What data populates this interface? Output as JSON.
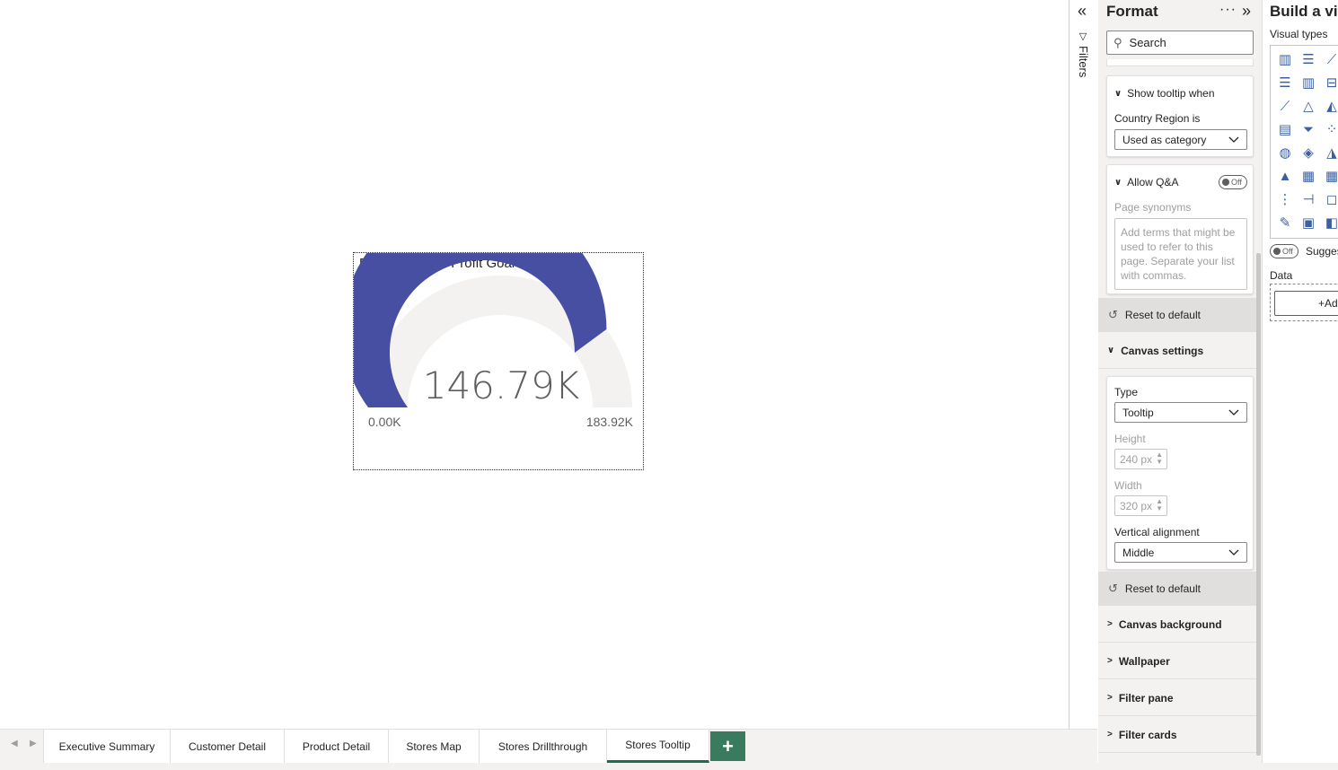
{
  "canvas": {
    "visual": {
      "title": "Profit YTD and Profit Goal",
      "gauge": {
        "value_label": "146.79K",
        "min_label": "0.00K",
        "max_label": "183.92K",
        "value": 146.79,
        "min": 0,
        "max": 183.92,
        "fill_color": "#464fa1",
        "track_color": "#f3f2f1"
      }
    }
  },
  "tabs": {
    "items": [
      {
        "label": "Executive Summary"
      },
      {
        "label": "Customer Detail"
      },
      {
        "label": "Product Detail"
      },
      {
        "label": "Stores Map"
      },
      {
        "label": "Stores Drillthrough"
      },
      {
        "label": "Stores Tooltip"
      }
    ],
    "active": "Stores Tooltip",
    "add_label": "+",
    "active_color": "#1b6f4e"
  },
  "filters": {
    "label": "Filters",
    "collapse_icon": "«"
  },
  "format": {
    "title": "Format",
    "more_icon": "···",
    "expand_icon": "»",
    "search_placeholder": "Search",
    "tooltip_section": {
      "title": "Show tooltip when",
      "field_label": "Country Region is",
      "dropdown_value": "Used as category"
    },
    "qa_section": {
      "title": "Allow Q&A",
      "toggle_label": "Off",
      "synonyms_label": "Page synonyms",
      "synonyms_placeholder": "Add terms that might be used to refer to this page. Separate your list with commas."
    },
    "reset_label": "Reset to default",
    "canvas_settings": {
      "title": "Canvas settings",
      "type_label": "Type",
      "type_value": "Tooltip",
      "height_label": "Height",
      "height_value": "240 px",
      "width_label": "Width",
      "width_value": "320 px",
      "valign_label": "Vertical alignment",
      "valign_value": "Middle"
    },
    "reset_label_2": "Reset to default",
    "sections": [
      {
        "title": "Canvas background"
      },
      {
        "title": "Wallpaper"
      },
      {
        "title": "Filter pane"
      },
      {
        "title": "Filter cards"
      }
    ]
  },
  "build": {
    "title": "Build a visu",
    "visual_types_label": "Visual types",
    "suggest_toggle": "Off",
    "suggest_label": "Sugges",
    "data_label": "Data",
    "add_label": "+Ad"
  }
}
